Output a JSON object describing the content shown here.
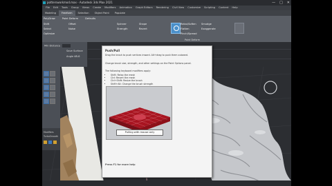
{
  "window": {
    "title": "pottersworkmod.max - Autodesk 3ds Max 2021",
    "controls": [
      "—",
      "□",
      "✕"
    ]
  },
  "menubar": [
    "File",
    "Edit",
    "Tools",
    "Group",
    "Views",
    "Create",
    "Modifiers",
    "Animation",
    "Graph Editors",
    "Rendering",
    "Civil View",
    "Customize",
    "Scripting",
    "Content",
    "Help"
  ],
  "ribbon": {
    "tabs": [
      "Modeling",
      "Freeform",
      "Selection",
      "Object Paint",
      "Populate"
    ],
    "active_tab": "Freeform",
    "subtabs": [
      "PolyDraw",
      "Paint Deform",
      "Defaults"
    ],
    "items": [
      "Shift",
      "Select",
      "Optimize",
      "Offset",
      "Noise",
      "Spinner",
      "Strength",
      "Shape",
      "Revert",
      "Relax/Soften",
      "Flatten",
      "Pinch/Spread",
      "Smudge",
      "Exaggerate",
      "Push/Pull"
    ],
    "panel_label": "Paint Deform"
  },
  "left_panel": {
    "brush_label": "Min Distance",
    "brush_value": "10",
    "sculpt_label": "Save Surface",
    "angle_label": "Angle",
    "angle_value": "45.0"
  },
  "tooltip": {
    "title": "Push/Pull",
    "description": "Drag the brush to push vertices inward. Alt+drag to push them outward.",
    "description2": "Change brush size, strength, and other settings on the Paint Options panel.",
    "modifiers_intro": "The following keyboard modifiers apply:",
    "modifiers": [
      "Shift: Relax the mesh",
      "Ctrl: Revert the mesh",
      "Ctrl+Shift: Resize the brush",
      "Shift+Alt: Change the brush strength"
    ],
    "image_caption": "Pulling with mouse only",
    "help": "Press F1 for more help"
  },
  "modifier_panel": {
    "lines": [
      "Modifiers",
      "TurboSmooth"
    ],
    "swatch_colors": [
      "#d0a030",
      "#3a76c0",
      "#d0a030"
    ]
  },
  "colors": {
    "accent": "#4a8fc9",
    "mesh": "#c5c7cb",
    "wood": "#a2835e",
    "paint": "#c01828"
  }
}
